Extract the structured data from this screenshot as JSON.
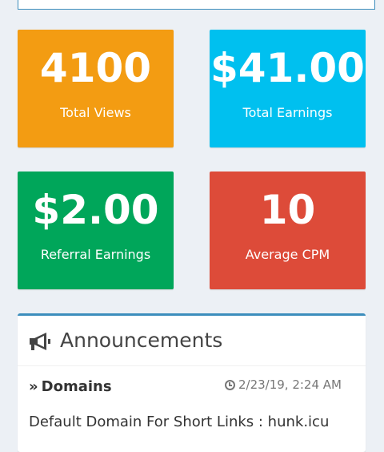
{
  "stats": [
    {
      "value": "4100",
      "label": "Total Views",
      "color": "#f39c12"
    },
    {
      "value": "$41.00",
      "label": "Total Earnings",
      "color": "#00c0ef"
    },
    {
      "value": "$2.00",
      "label": "Referral Earnings",
      "color": "#00a65a"
    },
    {
      "value": "10",
      "label": "Average CPM",
      "color": "#dd4b39"
    }
  ],
  "announcements": {
    "icon": "bullhorn-icon",
    "title": "Announcements",
    "items": [
      {
        "title_icon": "double-chevron-right-icon",
        "title": "Domains",
        "date_icon": "clock-icon",
        "date": "2/23/19, 2:24 AM",
        "body": "Default Domain For Short Links : hunk.icu"
      }
    ]
  },
  "theme": {
    "background": "#ecf0f5",
    "accent": "#3c8dbc"
  }
}
